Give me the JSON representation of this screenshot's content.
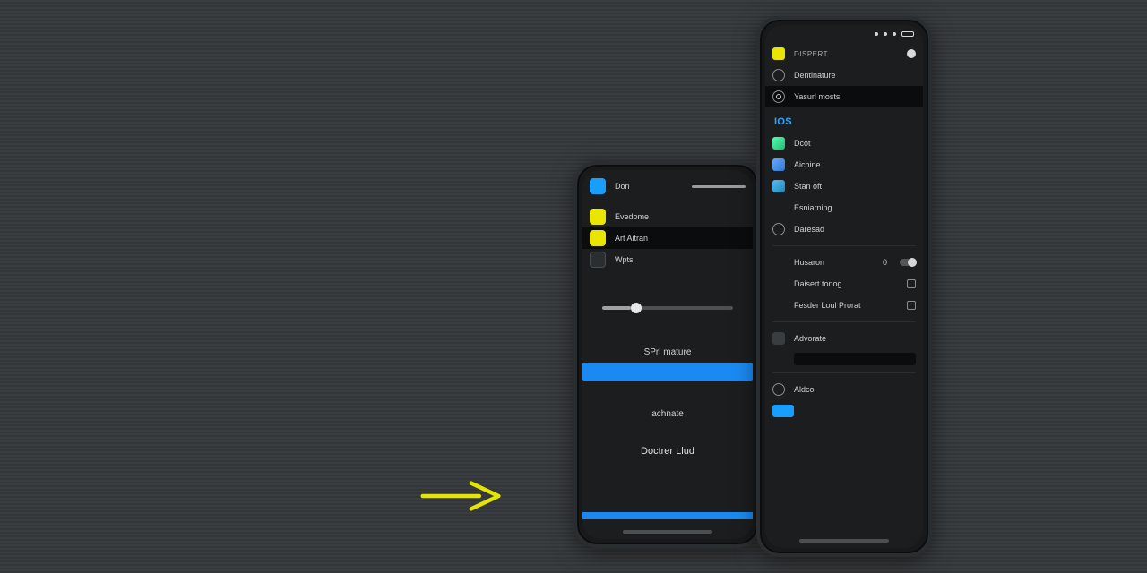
{
  "arrow": {
    "name": "arrow-right-icon"
  },
  "phone_left": {
    "rows": [
      {
        "label": "Don",
        "square": "c-blue",
        "kind": "with-slider"
      },
      {
        "label": "Evedome",
        "square": "c-yellow"
      },
      {
        "label": "Art Aitran",
        "square": "c-yellow",
        "selected": true
      },
      {
        "label": "Wpts",
        "square": "c-dark"
      }
    ],
    "slider_value": 22,
    "btn_primary": "SPrl mature",
    "section_a": "achnate",
    "section_b": "Doctrer Llud"
  },
  "phone_right": {
    "header": {
      "square": "c-yellow",
      "label": "DISPERT",
      "dot": true
    },
    "top_rows": [
      {
        "icon": "ring",
        "label": "Dentinature"
      },
      {
        "icon": "ring-target",
        "label": "Yasurl mosts",
        "selected": true
      }
    ],
    "group_title": "IOS",
    "group_rows": [
      {
        "square": "c-icon1",
        "label": "Dcot"
      },
      {
        "square": "c-icon2",
        "label": "Aichine"
      },
      {
        "square": "c-icon3",
        "label": "Stan oft"
      },
      {
        "square": null,
        "label": "Esniarning"
      },
      {
        "icon": "ring-off",
        "label": "Daresad"
      }
    ],
    "option_rows": [
      {
        "label": "Husaron",
        "trail": "toggle",
        "value": "0"
      },
      {
        "label": "Daisert tonog",
        "trail": "box"
      },
      {
        "label": "Fesder Loul Prorat",
        "trail": "box"
      }
    ],
    "advanced": {
      "square": "c-grey",
      "label": "Advorate"
    },
    "last": {
      "icon": "ring",
      "label": "Aldco"
    },
    "blue_chip": true
  }
}
